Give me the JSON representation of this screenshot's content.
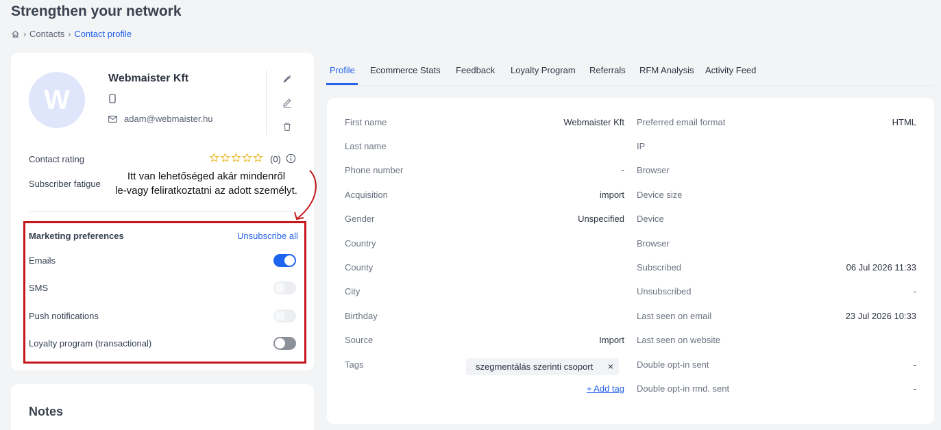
{
  "page": {
    "title": "Strengthen your network",
    "breadcrumb": [
      "Contacts",
      "Contact profile"
    ]
  },
  "contact": {
    "initial": "W",
    "name": "Webmaister Kft",
    "email": "adam@webmaister.hu",
    "rating_label": "Contact rating",
    "rating_count": "(0)",
    "rating_stars": 0,
    "fatigue_label": "Subscriber fatigue"
  },
  "annotation": {
    "line1": "Itt van lehetőséged akár mindenről",
    "line2": "le-vagy feliratkoztatni az adott személyt."
  },
  "marketing": {
    "title": "Marketing preferences",
    "unsubscribe_all": "Unsubscribe all",
    "items": [
      {
        "label": "Emails",
        "state": "on"
      },
      {
        "label": "SMS",
        "state": "disabled"
      },
      {
        "label": "Push notifications",
        "state": "disabled"
      },
      {
        "label": "Loyalty program (transactional)",
        "state": "off"
      }
    ]
  },
  "notes": {
    "title": "Notes"
  },
  "tabs": [
    "Profile",
    "Ecommerce Stats",
    "Feedback",
    "Loyalty Program",
    "Referrals",
    "RFM Analysis",
    "Activity Feed"
  ],
  "profile": {
    "left": [
      {
        "label": "First name",
        "value": "Webmaister Kft"
      },
      {
        "label": "Last name",
        "value": ""
      },
      {
        "label": "Phone number",
        "value": "-"
      },
      {
        "label": "Acquisition",
        "value": "import"
      },
      {
        "label": "Gender",
        "value": "Unspecified"
      },
      {
        "label": "Country",
        "value": ""
      },
      {
        "label": "County",
        "value": ""
      },
      {
        "label": "City",
        "value": ""
      },
      {
        "label": "Birthday",
        "value": ""
      },
      {
        "label": "Source",
        "value": "Import"
      },
      {
        "label": "Tags",
        "value": ""
      }
    ],
    "tag": "szegmentálás szerinti csoport",
    "tag_remove": "×",
    "add_tag": "+ Add tag",
    "right": [
      {
        "label": "Preferred email format",
        "value": "HTML"
      },
      {
        "label": "IP",
        "value": ""
      },
      {
        "label": "Browser",
        "value": ""
      },
      {
        "label": "Device size",
        "value": ""
      },
      {
        "label": "Device",
        "value": ""
      },
      {
        "label": "Browser",
        "value": ""
      },
      {
        "label": "Subscribed",
        "value": "06 Jul 2026 11:33"
      },
      {
        "label": "Unsubscribed",
        "value": "-"
      },
      {
        "label": "Last seen on email",
        "value": "23 Jul 2026 10:33"
      },
      {
        "label": "Last seen on website",
        "value": ""
      },
      {
        "label": "Double opt-in sent",
        "value": "-"
      },
      {
        "label": "Double opt-in rmd. sent",
        "value": "-"
      }
    ]
  }
}
